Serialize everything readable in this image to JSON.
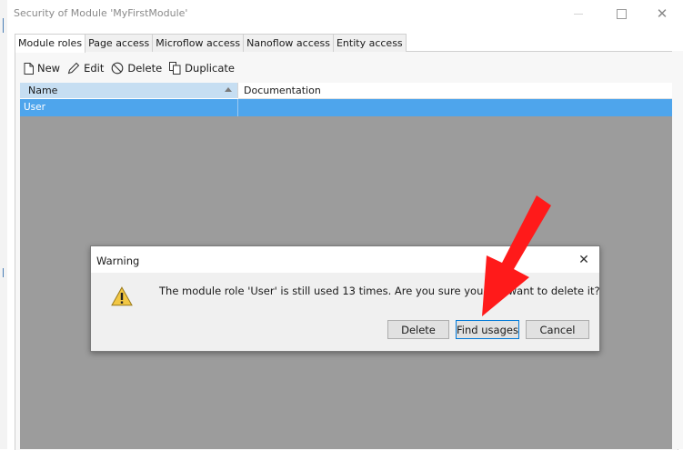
{
  "window": {
    "title": "Security of Module 'MyFirstModule'",
    "close_glyph": "✕"
  },
  "tabs": [
    {
      "label": "Module roles",
      "active": true
    },
    {
      "label": "Page access",
      "active": false
    },
    {
      "label": "Microflow access",
      "active": false
    },
    {
      "label": "Nanoflow access",
      "active": false
    },
    {
      "label": "Entity access",
      "active": false
    }
  ],
  "toolbar": {
    "new_label": "New",
    "edit_label": "Edit",
    "delete_label": "Delete",
    "duplicate_label": "Duplicate"
  },
  "grid": {
    "columns": [
      "Name",
      "Documentation"
    ],
    "sort": "Name ascending",
    "rows": [
      {
        "name": "User",
        "documentation": "",
        "selected": true
      }
    ]
  },
  "dialog": {
    "title": "Warning",
    "close_glyph": "✕",
    "icon": "warning-icon",
    "message": "The module role 'User' is still used 13 times. Are you sure you still want to delete it?",
    "buttons": {
      "delete": "Delete",
      "find_usages": "Find usages",
      "cancel": "Cancel"
    }
  },
  "annotation": {
    "shape": "red-arrow",
    "color": "#ff1a1a",
    "points_to": "Find usages"
  },
  "colors": {
    "selection": "#4ea5ec",
    "header_sorted": "#c6def2",
    "modal_overlay": "#9c9c9c",
    "focus_border": "#0078d7"
  }
}
